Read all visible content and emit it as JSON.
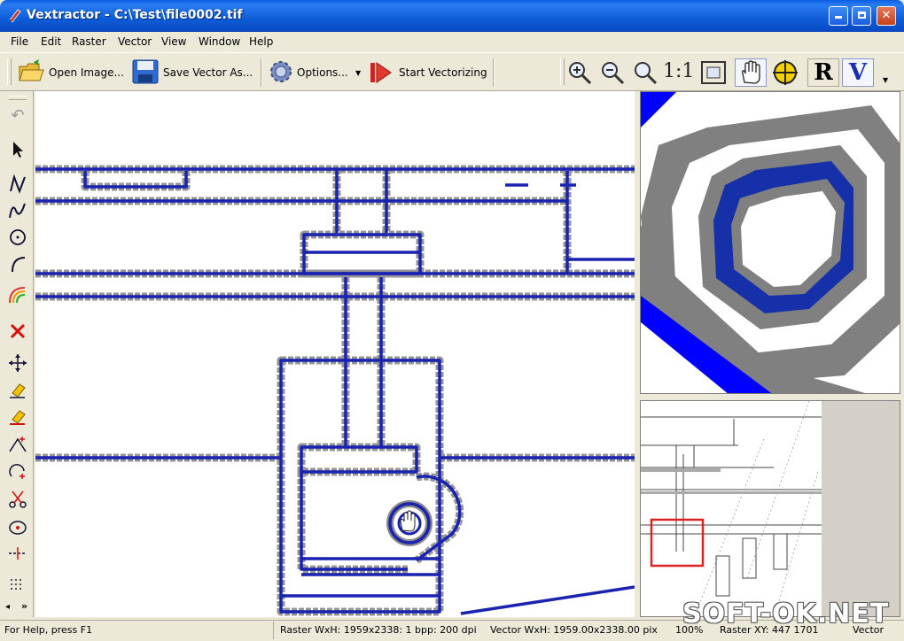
{
  "window": {
    "title": "Vextractor - C:\\Test\\file0002.tif"
  },
  "menu": [
    "File",
    "Edit",
    "Raster",
    "Vector",
    "View",
    "Window",
    "Help"
  ],
  "toolbar": {
    "open_label": "Open Image...",
    "save_label": "Save Vector As...",
    "options_label": "Options...",
    "start_label": "Start Vectorizing",
    "one_to_one": "1:1",
    "r_label": "R",
    "v_label": "V"
  },
  "status": {
    "help": "For Help, press F1",
    "raster": "Raster WxH: 1959x2338: 1 bpp: 200 dpi",
    "vector": "Vector WxH: 1959.00x2338.00 pix",
    "zoom": "100%",
    "raster_xy": "Raster XY: 447 1701",
    "vector_label": "Vector"
  },
  "watermark": "SOFT-OK.NET",
  "colors": {
    "titlebar": "#0a5ee6",
    "vector_line": "#1a1ab0",
    "raster_gray": "#808080",
    "highlight": "#0000ff",
    "overview_box": "#dd2222"
  }
}
